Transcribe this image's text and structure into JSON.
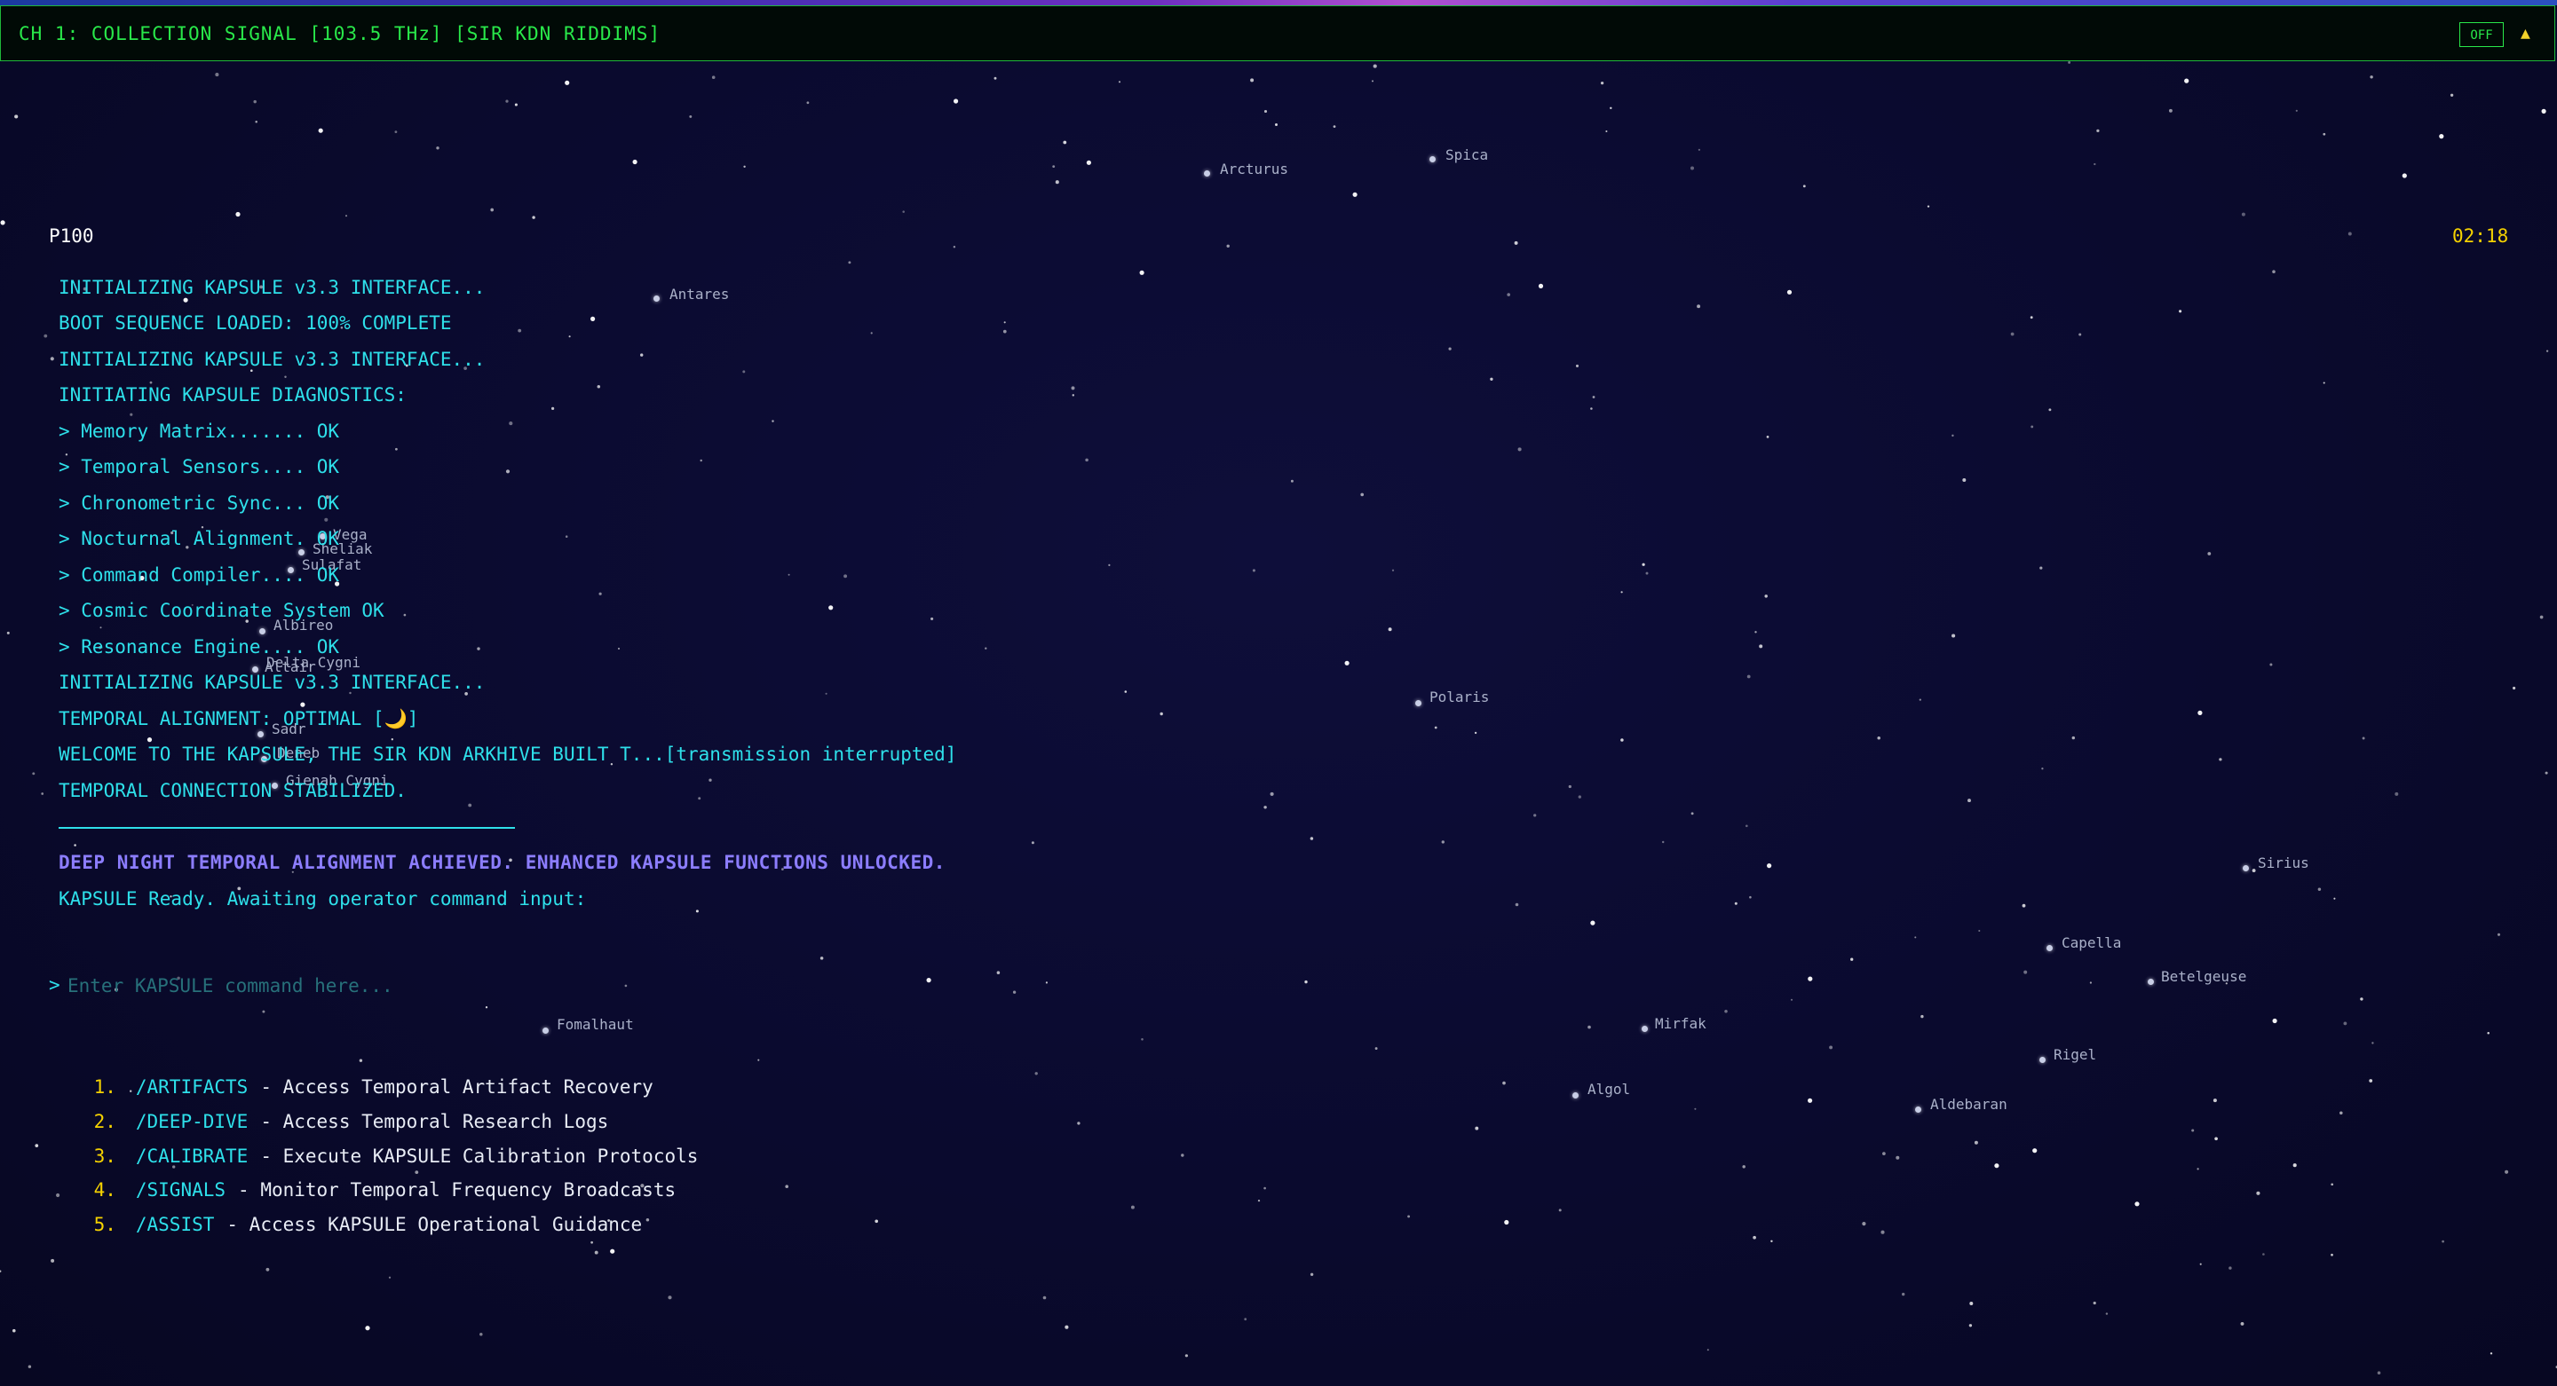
{
  "radio": {
    "title": "CH 1: COLLECTION SIGNAL [103.5 THz] [SIR KDN RIDDIMS]",
    "off_label": "OFF",
    "toggle_icon": "▲"
  },
  "header": {
    "left_label": "P100",
    "clock": "02:18"
  },
  "terminal": {
    "lines": [
      "INITIALIZING KAPSULE v3.3 INTERFACE...",
      "BOOT SEQUENCE LOADED: 100% COMPLETE",
      "INITIALIZING KAPSULE v3.3 INTERFACE...",
      "INITIATING KAPSULE DIAGNOSTICS:",
      "> Memory Matrix....... OK",
      "> Temporal Sensors.... OK",
      "> Chronometric Sync... OK",
      "> Nocturnal Alignment. OK",
      "> Command Compiler.... OK",
      "> Cosmic Coordinate System OK",
      "> Resonance Engine.... OK",
      "INITIALIZING KAPSULE v3.3 INTERFACE...",
      "TEMPORAL ALIGNMENT: OPTIMAL [🌙]",
      "WELCOME TO THE KAPSULE, THE SIR KDN ARKHIVE BUILT T...[transmission interrupted]",
      "TEMPORAL CONNECTION STABILIZED."
    ],
    "achievement": "DEEP NIGHT TEMPORAL ALIGNMENT ACHIEVED. ENHANCED KAPSULE FUNCTIONS UNLOCKED.",
    "ready": "KAPSULE Ready. Awaiting operator command input:"
  },
  "command": {
    "prompt": ">",
    "placeholder": "Enter KAPSULE command here..."
  },
  "menu": [
    {
      "num": "1.",
      "cmd": "/ARTIFACTS",
      "desc": "- Access Temporal Artifact Recovery"
    },
    {
      "num": "2.",
      "cmd": "/DEEP-DIVE",
      "desc": "- Access Temporal Research Logs"
    },
    {
      "num": "3.",
      "cmd": "/CALIBRATE",
      "desc": "- Execute KAPSULE Calibration Protocols"
    },
    {
      "num": "4.",
      "cmd": "/SIGNALS",
      "desc": "- Monitor Temporal Frequency Broadcasts"
    },
    {
      "num": "5.",
      "cmd": "/ASSIST",
      "desc": "- Access KAPSULE Operational Guidance"
    }
  ],
  "stars": [
    "Arcturus",
    "Spica",
    "Antares",
    "Vega",
    "Sheliak",
    "Sulafat",
    "Albireo",
    "Delta Cygni",
    "Altair",
    "Sadr",
    "Deneb",
    "Gienah Cygni",
    "Polaris",
    "Sirius",
    "Capella",
    "Betelgeuse",
    "Mirfak",
    "Rigel",
    "Algol",
    "Aldebaran",
    "Fomalhaut"
  ],
  "colors": {
    "background": "#0a0a2e",
    "radio_green": "#29e84a",
    "terminal_cyan": "#2ee0ea",
    "accent_yellow": "#f5d200",
    "achievement_purple": "#8c7dff"
  }
}
